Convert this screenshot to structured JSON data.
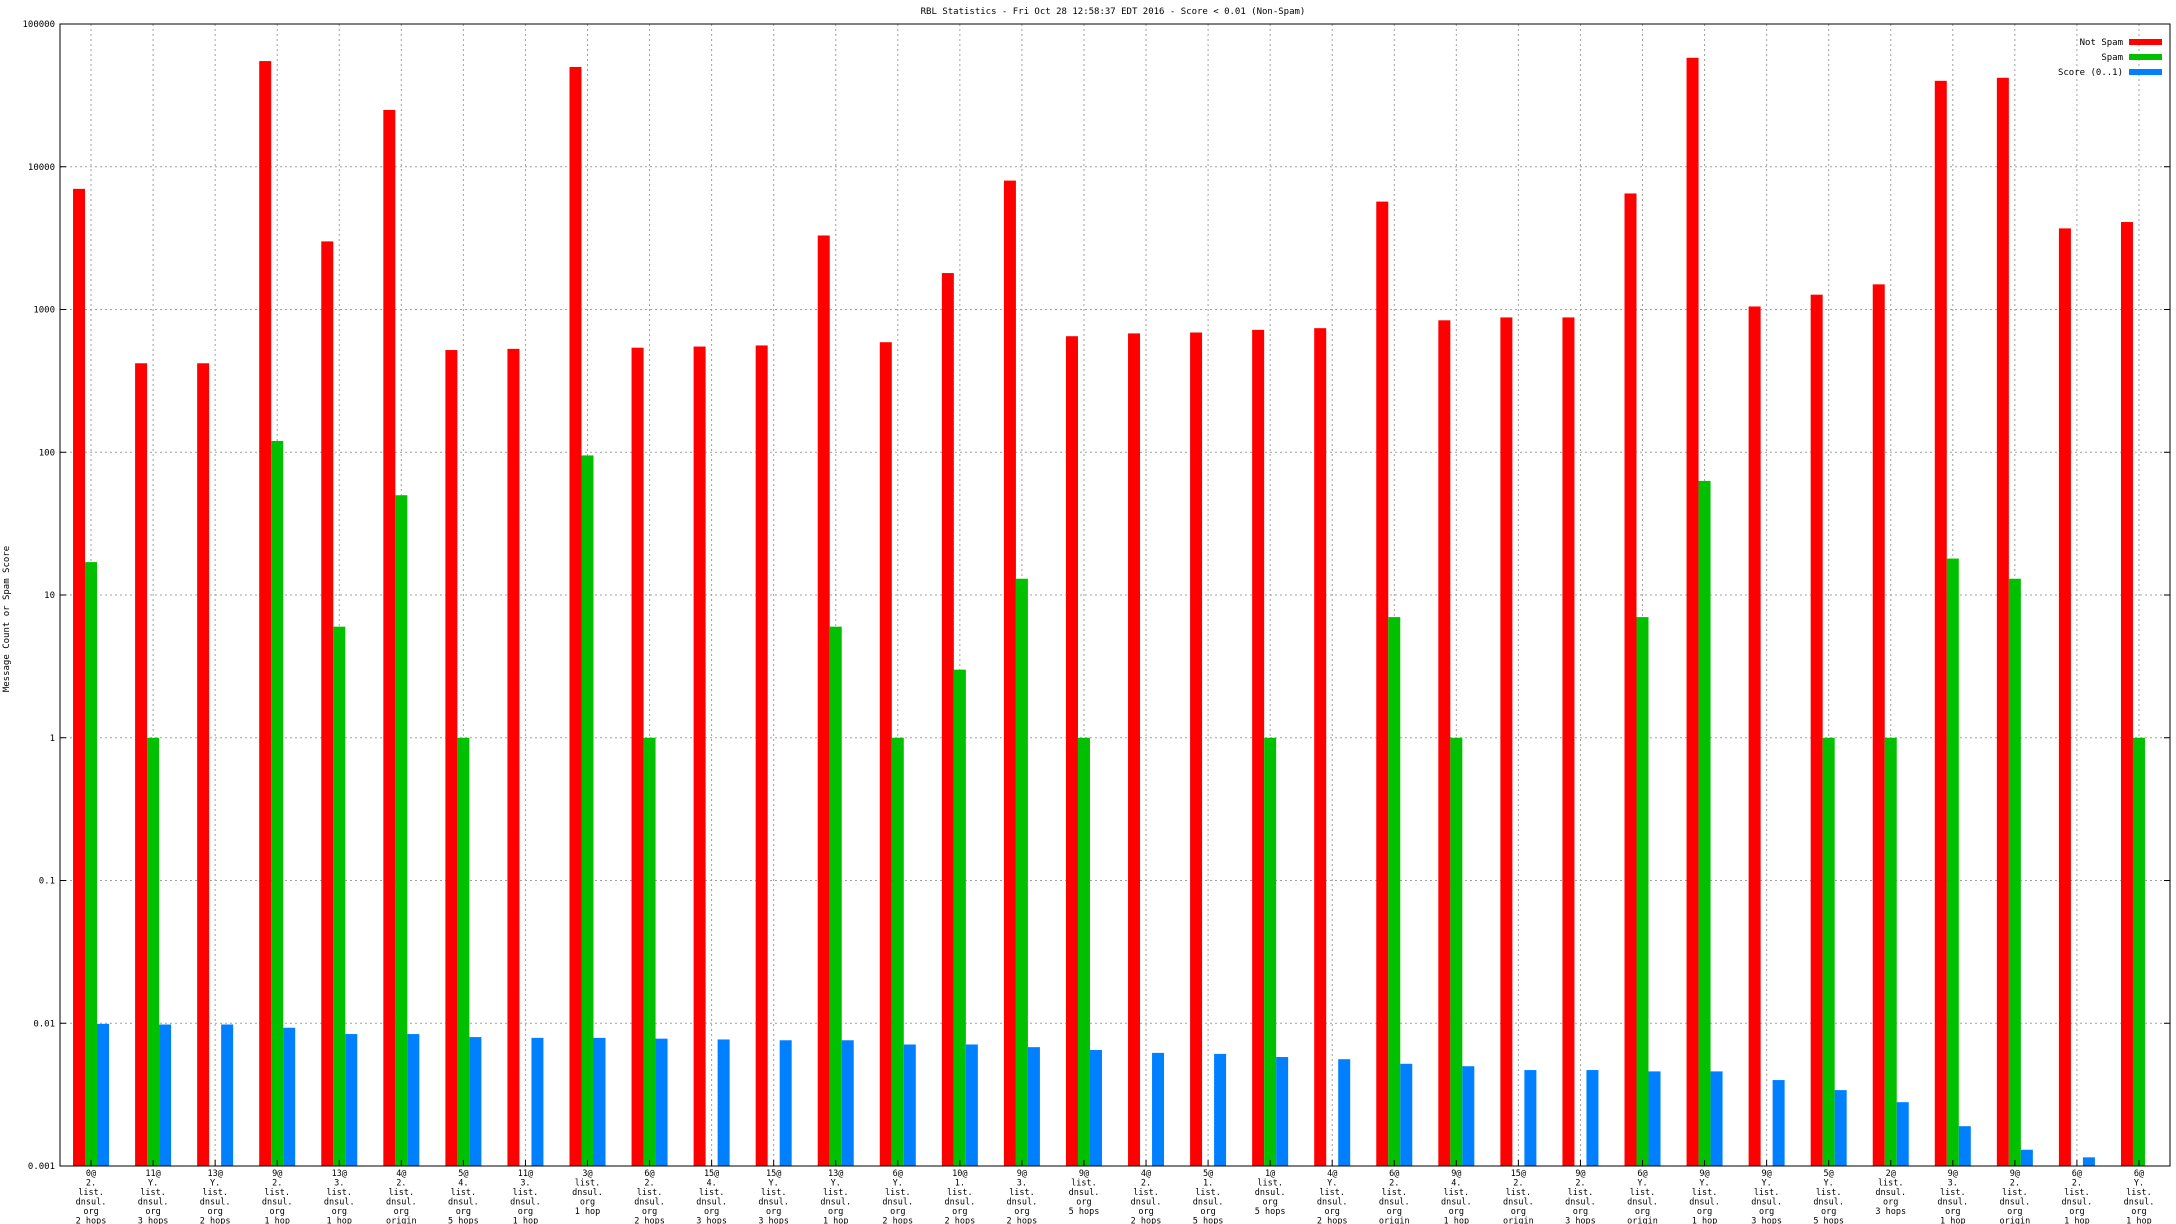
{
  "chart_data": {
    "type": "bar",
    "title": "RBL Statistics - Fri Oct 28 12:58:37 EDT 2016 - Score < 0.01 (Non-Spam)",
    "ylabel": "Message Count or Spam Score",
    "xlabel": "",
    "yscale": "log",
    "ylim": [
      0.001,
      100000
    ],
    "yticks": [
      "0.001",
      "0.01",
      "0.1",
      "1",
      "10",
      "100",
      "1000",
      "10000",
      "100000"
    ],
    "grid": true,
    "legend_position": "top-right",
    "colors": {
      "Not Spam": "#ff0000",
      "Spam": "#00c000",
      "Score (0..1)": "#0080ff"
    },
    "categories": [
      [
        "0@",
        "2.",
        "list.",
        "dnsul.",
        "org",
        "2 hops"
      ],
      [
        "11@",
        "Y.",
        "list.",
        "dnsul.",
        "org",
        "3 hops"
      ],
      [
        "13@",
        "Y.",
        "list.",
        "dnsul.",
        "org",
        "2 hops"
      ],
      [
        "9@",
        "2.",
        "list.",
        "dnsul.",
        "org",
        "1 hop"
      ],
      [
        "13@",
        "3.",
        "list.",
        "dnsul.",
        "org",
        "1 hop"
      ],
      [
        "4@",
        "2.",
        "list.",
        "dnsul.",
        "org",
        "origin"
      ],
      [
        "5@",
        "4.",
        "list.",
        "dnsul.",
        "org",
        "5 hops"
      ],
      [
        "11@",
        "3.",
        "list.",
        "dnsul.",
        "org",
        "1 hop"
      ],
      [
        "3@",
        "list.",
        "dnsul.",
        "org",
        "1 hop"
      ],
      [
        "6@",
        "2.",
        "list.",
        "dnsul.",
        "org",
        "2 hops"
      ],
      [
        "15@",
        "4.",
        "list.",
        "dnsul.",
        "org",
        "3 hops"
      ],
      [
        "15@",
        "Y.",
        "list.",
        "dnsul.",
        "org",
        "3 hops"
      ],
      [
        "13@",
        "Y.",
        "list.",
        "dnsul.",
        "org",
        "1 hop"
      ],
      [
        "6@",
        "Y.",
        "list.",
        "dnsul.",
        "org",
        "2 hops"
      ],
      [
        "10@",
        "1.",
        "list.",
        "dnsul.",
        "org",
        "2 hops"
      ],
      [
        "9@",
        "3.",
        "list.",
        "dnsul.",
        "org",
        "2 hops"
      ],
      [
        "9@",
        "list.",
        "dnsul.",
        "org",
        "5 hops"
      ],
      [
        "4@",
        "2.",
        "list.",
        "dnsul.",
        "org",
        "2 hops"
      ],
      [
        "5@",
        "1.",
        "list.",
        "dnsul.",
        "org",
        "5 hops"
      ],
      [
        "1@",
        "list.",
        "dnsul.",
        "org",
        "5 hops"
      ],
      [
        "4@",
        "Y.",
        "list.",
        "dnsul.",
        "org",
        "2 hops"
      ],
      [
        "6@",
        "2.",
        "list.",
        "dnsul.",
        "org",
        "origin"
      ],
      [
        "9@",
        "4.",
        "list.",
        "dnsul.",
        "org",
        "1 hop"
      ],
      [
        "15@",
        "2.",
        "list.",
        "dnsul.",
        "org",
        "origin"
      ],
      [
        "9@",
        "2.",
        "list.",
        "dnsul.",
        "org",
        "3 hops"
      ],
      [
        "6@",
        "Y.",
        "list.",
        "dnsul.",
        "org",
        "origin"
      ],
      [
        "9@",
        "Y.",
        "list.",
        "dnsul.",
        "org",
        "1 hop"
      ],
      [
        "9@",
        "Y.",
        "list.",
        "dnsul.",
        "org",
        "3 hops"
      ],
      [
        "5@",
        "Y.",
        "list.",
        "dnsul.",
        "org",
        "5 hops"
      ],
      [
        "2@",
        "list.",
        "dnsul.",
        "org",
        "3 hops"
      ],
      [
        "9@",
        "3.",
        "list.",
        "dnsul.",
        "org",
        "1 hop"
      ],
      [
        "9@",
        "2.",
        "list.",
        "dnsul.",
        "org",
        "origin"
      ],
      [
        "6@",
        "2.",
        "list.",
        "dnsul.",
        "org",
        "1 hop"
      ],
      [
        "6@",
        "Y.",
        "list.",
        "dnsul.",
        "org",
        "1 hop"
      ]
    ],
    "series": [
      {
        "name": "Not Spam",
        "values": [
          7000,
          420,
          420,
          55000,
          3000,
          25000,
          520,
          530,
          50000,
          540,
          550,
          560,
          3300,
          590,
          1800,
          8000,
          650,
          680,
          690,
          720,
          740,
          5700,
          840,
          880,
          880,
          6500,
          58000,
          1050,
          1270,
          1500,
          40000,
          42000,
          3700,
          4100
        ]
      },
      {
        "name": "Spam",
        "values": [
          17,
          1,
          null,
          120,
          6,
          50,
          1,
          null,
          95,
          1,
          null,
          null,
          6,
          1,
          3,
          13,
          1,
          null,
          null,
          1,
          null,
          7,
          1,
          null,
          null,
          7,
          63,
          null,
          1,
          1,
          18,
          13,
          null,
          1
        ]
      },
      {
        "name": "Score (0..1)",
        "values": [
          0.0099,
          0.0098,
          0.0098,
          0.0093,
          0.0084,
          0.0084,
          0.008,
          0.0079,
          0.0079,
          0.0078,
          0.0077,
          0.0076,
          0.0076,
          0.0071,
          0.0071,
          0.0068,
          0.0065,
          0.0062,
          0.0061,
          0.0058,
          0.0056,
          0.0052,
          0.005,
          0.0047,
          0.0047,
          0.0046,
          0.0046,
          0.004,
          0.0034,
          0.0028,
          0.0019,
          0.0013,
          0.00115,
          null
        ]
      }
    ]
  }
}
